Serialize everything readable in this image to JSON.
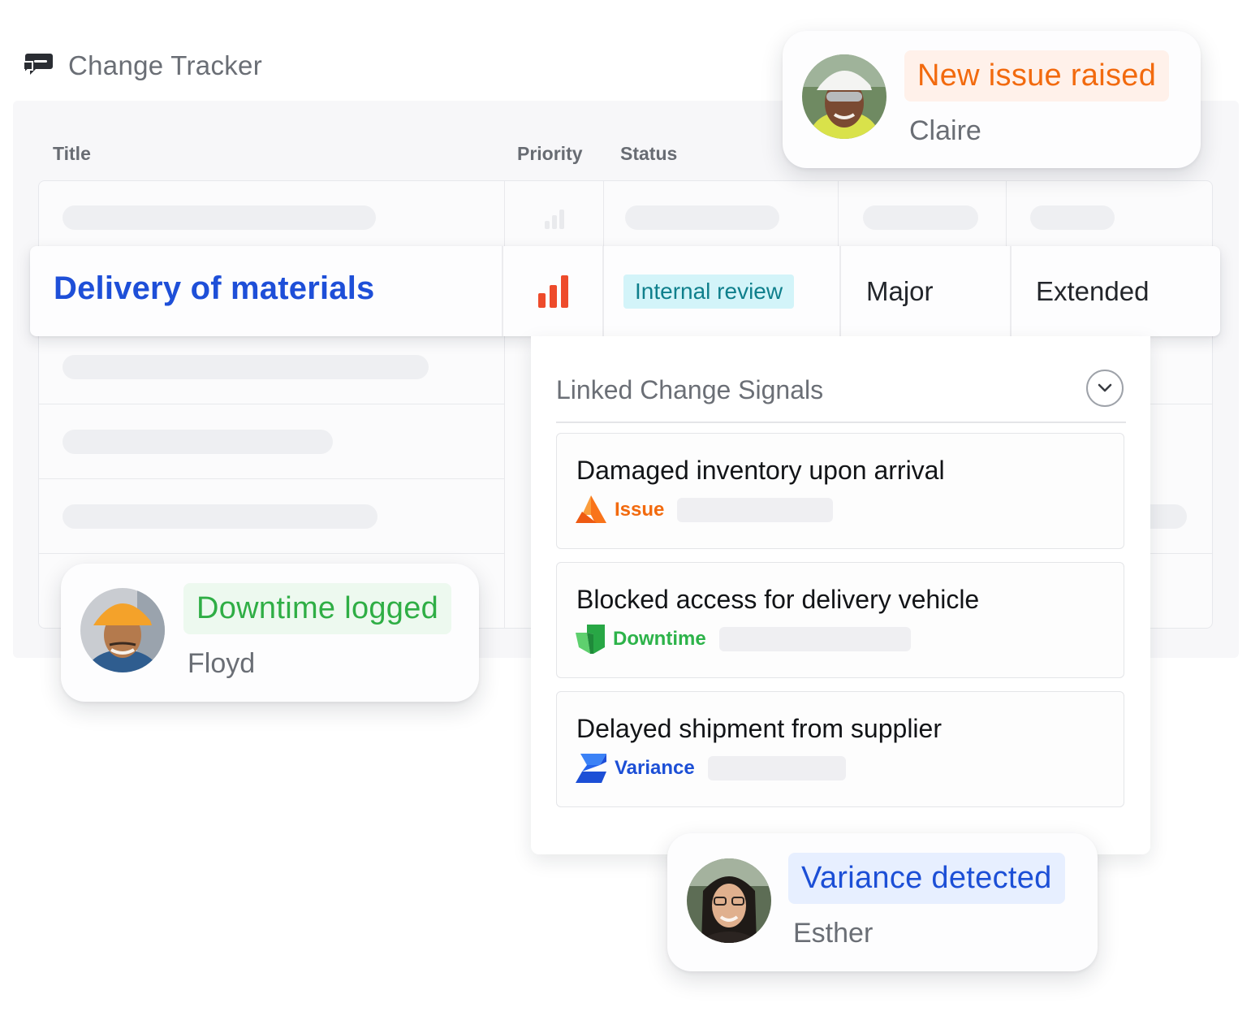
{
  "app": {
    "title": "Change Tracker",
    "logo_icon": "chat-bubbles-icon"
  },
  "table": {
    "columns": {
      "title": "Title",
      "priority": "Priority",
      "status": "Status"
    },
    "featured_row": {
      "title": "Delivery of materials",
      "priority_icon": "priority-high-bars-icon",
      "status": "Internal review",
      "impact": "Major",
      "schedule": "Extended"
    }
  },
  "signals": {
    "heading": "Linked Change Signals",
    "toggle_icon": "chevron-down-icon",
    "items": [
      {
        "title": "Damaged inventory upon arrival",
        "tag": "Issue",
        "tag_color": "#f26a0e",
        "tag_icon": "issue-icon"
      },
      {
        "title": "Blocked access for delivery vehicle",
        "tag": "Downtime",
        "tag_color": "#2db34a",
        "tag_icon": "downtime-icon"
      },
      {
        "title": "Delayed shipment from supplier",
        "tag": "Variance",
        "tag_color": "#1c4fd6",
        "tag_icon": "variance-icon"
      }
    ]
  },
  "notifications": {
    "issue": {
      "label": "New issue raised",
      "name": "Claire",
      "color": "#f26a0e",
      "bg": "#fff1ea"
    },
    "downtime": {
      "label": "Downtime logged",
      "name": "Floyd",
      "color": "#2fae45",
      "bg": "#edf9ef"
    },
    "variance": {
      "label": "Variance detected",
      "name": "Esther",
      "color": "#1c4fd6",
      "bg": "#e7efff"
    }
  }
}
